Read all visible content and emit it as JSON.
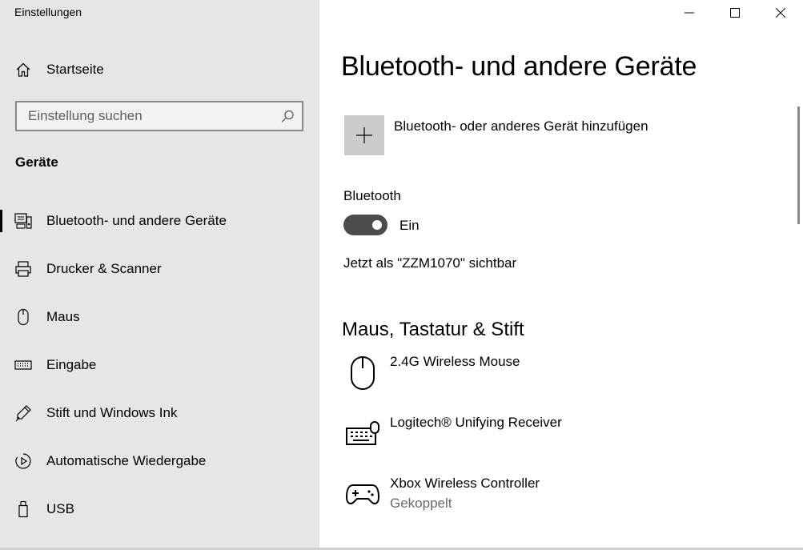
{
  "window": {
    "title": "Einstellungen"
  },
  "sidebar": {
    "home_label": "Startseite",
    "search_placeholder": "Einstellung suchen",
    "section_heading": "Geräte",
    "items": [
      {
        "label": "Bluetooth- und andere Geräte",
        "icon": "bluetooth-devices-icon",
        "active": true
      },
      {
        "label": "Drucker & Scanner",
        "icon": "printer-icon"
      },
      {
        "label": "Maus",
        "icon": "mouse-icon"
      },
      {
        "label": "Eingabe",
        "icon": "keyboard-icon"
      },
      {
        "label": "Stift und Windows Ink",
        "icon": "pen-icon"
      },
      {
        "label": "Automatische Wiedergabe",
        "icon": "autoplay-icon"
      },
      {
        "label": "USB",
        "icon": "usb-icon"
      }
    ]
  },
  "main": {
    "title": "Bluetooth- und andere Geräte",
    "add_device_label": "Bluetooth- oder anderes Gerät hinzufügen",
    "bluetooth": {
      "label": "Bluetooth",
      "state": "Ein",
      "visible_text": "Jetzt als \"ZZM1070\" sichtbar"
    },
    "section_heading": "Maus, Tastatur & Stift",
    "devices": [
      {
        "name": "2.4G Wireless Mouse",
        "status": "",
        "icon": "mouse-icon"
      },
      {
        "name": "Logitech® Unifying Receiver",
        "status": "",
        "icon": "keyboard-icon"
      },
      {
        "name": "Xbox Wireless Controller",
        "status": "Gekoppelt",
        "icon": "gamepad-icon"
      }
    ]
  },
  "colors": {
    "sidebar_bg": "#e6e6e6",
    "toggle_on": "#4c4c4c",
    "tile_bg": "#cccccc"
  }
}
